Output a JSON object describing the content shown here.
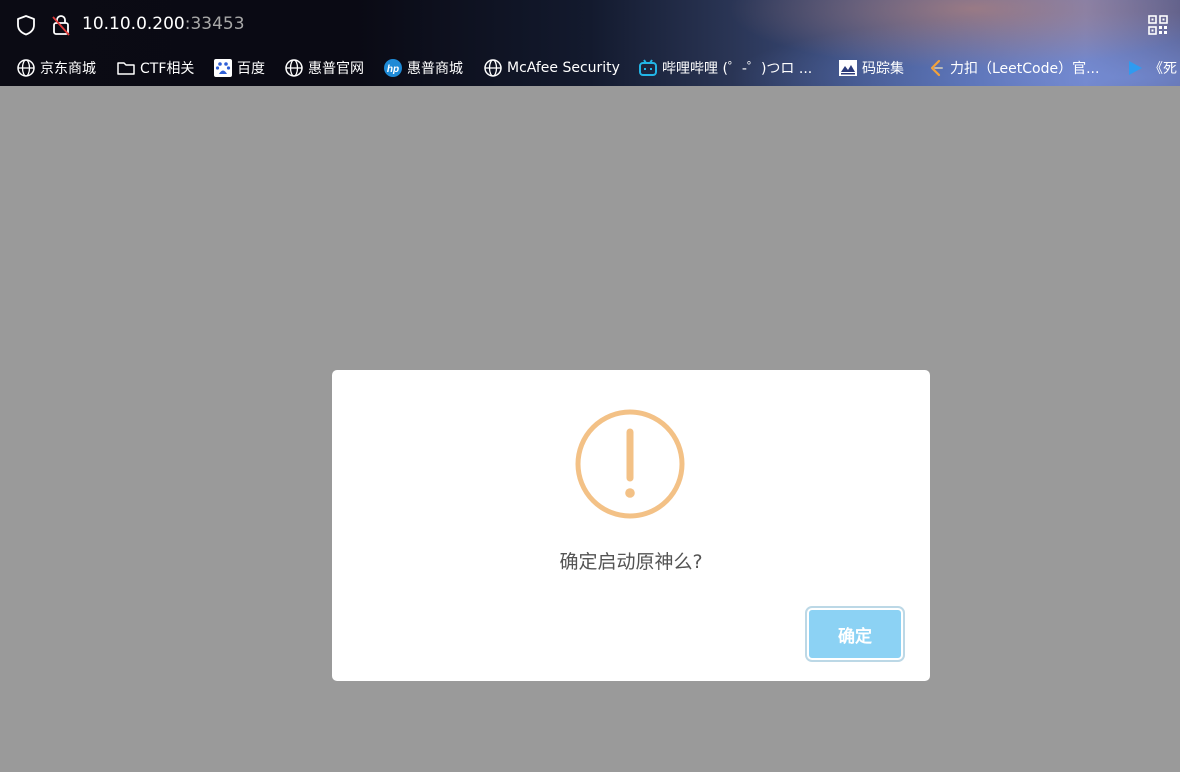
{
  "browser": {
    "url_host": "10.10.0.200",
    "url_port": ":33453",
    "icons": [
      "shield-icon",
      "lock-icon",
      "qr-code-icon"
    ]
  },
  "bookmarks": [
    {
      "label": "京东商城",
      "icon": "globe-icon"
    },
    {
      "label": "CTF相关",
      "icon": "folder-icon"
    },
    {
      "label": "百度",
      "icon": "baidu-icon"
    },
    {
      "label": "惠普官网",
      "icon": "globe-icon"
    },
    {
      "label": "惠普商城",
      "icon": "hp-icon"
    },
    {
      "label": "McAfee Security",
      "icon": "globe-icon"
    },
    {
      "label": "哔哩哔哩 (゜-゜)つロ ...",
      "icon": "bilibili-icon"
    },
    {
      "label": "码踪集",
      "icon": "site-icon"
    },
    {
      "label": "力扣（LeetCode）官...",
      "icon": "leetcode-icon"
    },
    {
      "label": "《死",
      "icon": "play-icon"
    }
  ],
  "dialog": {
    "icon": "warning-icon",
    "message": "确定启动原神么?",
    "confirm_label": "确定"
  },
  "colors": {
    "overlay": "#9a9a9a",
    "warning": "#f3c186",
    "confirm_button": "#8cd2f4",
    "message_text": "#545454"
  }
}
